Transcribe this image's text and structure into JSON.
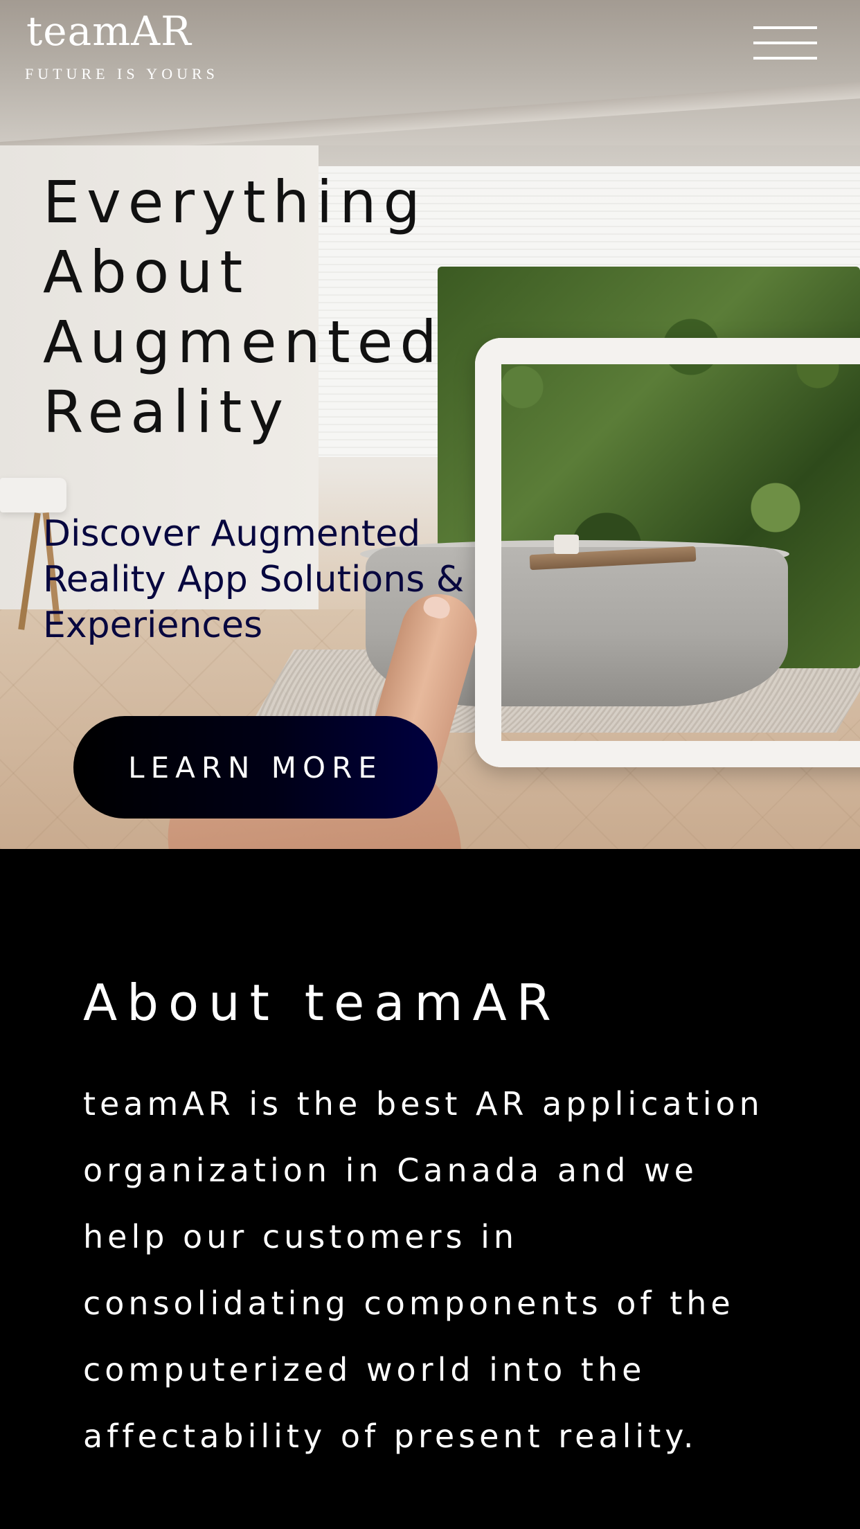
{
  "header": {
    "logo_text": "teamAR",
    "tagline": "FUTURE IS YOURS",
    "menu_icon": "hamburger-menu-icon"
  },
  "hero": {
    "headline_lines": [
      "Everything",
      "About",
      "Augmented",
      "Reality"
    ],
    "subheadline": "Discover Augmented Reality App Solutions & Experiences",
    "cta_label": "LEARN MORE",
    "background_image": "AR tablet showing bathroom with bathtub and green plant wall"
  },
  "about": {
    "title": "About teamAR",
    "body": "teamAR is the best AR application organization in Canada and we help our customers in consolidating components of the computerized world into the affectability of present reality."
  },
  "colors": {
    "cta_background": "#000000",
    "subheadline": "#07073f",
    "about_background": "#000000"
  }
}
